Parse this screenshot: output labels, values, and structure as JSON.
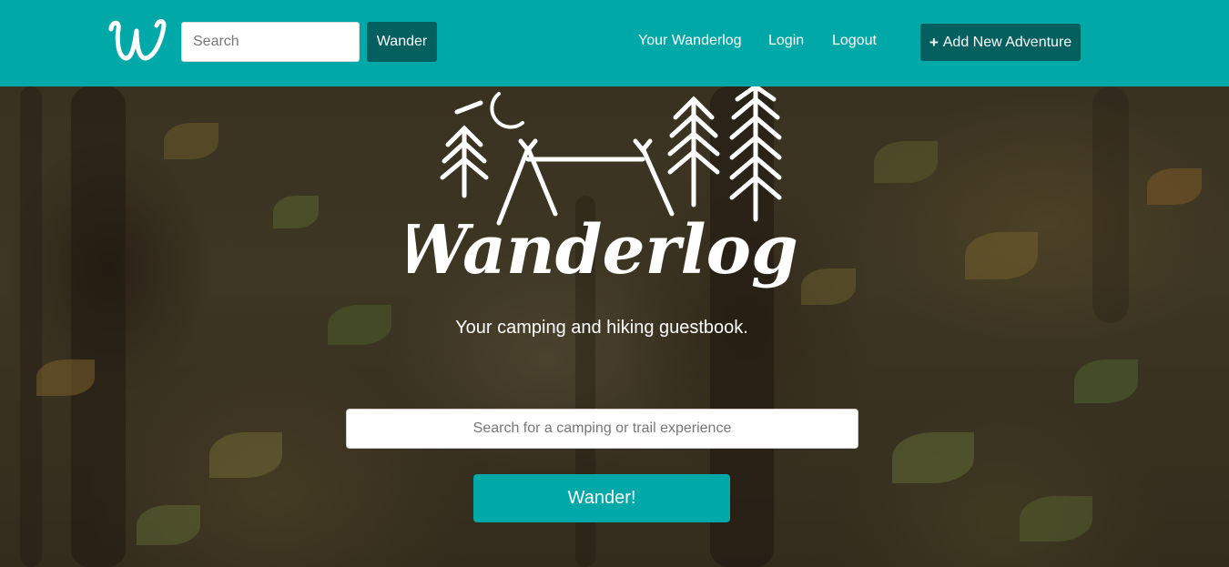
{
  "navbar": {
    "brand_logo": "W",
    "search_placeholder": "Search",
    "search_button": "Wander",
    "links": [
      "Your Wanderlog",
      "Login",
      "Logout"
    ],
    "add_button": "Add New Adventure",
    "add_icon": "+"
  },
  "hero": {
    "logo_text": "Wanderlog",
    "tagline": "Your camping and hiking guestbook.",
    "search_placeholder": "Search for a camping or trail experience",
    "submit_button": "Wander!"
  },
  "colors": {
    "primary": "#00a8a8",
    "dark_teal": "#045f5f",
    "text": "#ffffff"
  }
}
